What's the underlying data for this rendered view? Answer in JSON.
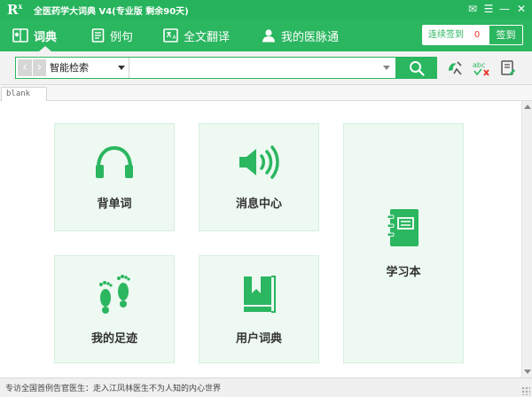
{
  "window": {
    "logo": "R",
    "logo_sup": "x",
    "title": "全医药学大词典 V4(专业版 剩余90天)",
    "buttons": {
      "skin": "✉",
      "menu": "☰",
      "minimize": "—",
      "close": "✕"
    }
  },
  "nav": {
    "items": [
      {
        "label": "词典",
        "icon": "dictionary-icon",
        "active": true
      },
      {
        "label": "例句",
        "icon": "document-icon",
        "active": false
      },
      {
        "label": "全文翻译",
        "icon": "translate-icon",
        "active": false
      },
      {
        "label": "我的医脉通",
        "icon": "user-icon",
        "active": false
      }
    ],
    "checkin": {
      "label": "连续签到",
      "count": "0",
      "button": "签到"
    }
  },
  "search": {
    "back": "‹",
    "forward": "›",
    "mode": "智能检索",
    "value": "",
    "placeholder": "",
    "tools": [
      "word-capture-icon",
      "spell-check-icon",
      "notes-icon"
    ]
  },
  "tabs": [
    {
      "label": "blank"
    }
  ],
  "tiles": [
    {
      "label": "背单词",
      "icon": "headphones-icon"
    },
    {
      "label": "消息中心",
      "icon": "speaker-icon"
    },
    {
      "label": "学习本",
      "icon": "notebook-icon"
    },
    {
      "label": "我的足迹",
      "icon": "footprints-icon"
    },
    {
      "label": "用户词典",
      "icon": "bookmark-book-icon"
    }
  ],
  "status": {
    "text": "专访全国首例告官医生：走入江凤林医生不为人知的内心世界"
  },
  "colors": {
    "brand_green": "#2bb660",
    "tile_bg": "#edf9f1",
    "accent_red": "#e8352a"
  }
}
